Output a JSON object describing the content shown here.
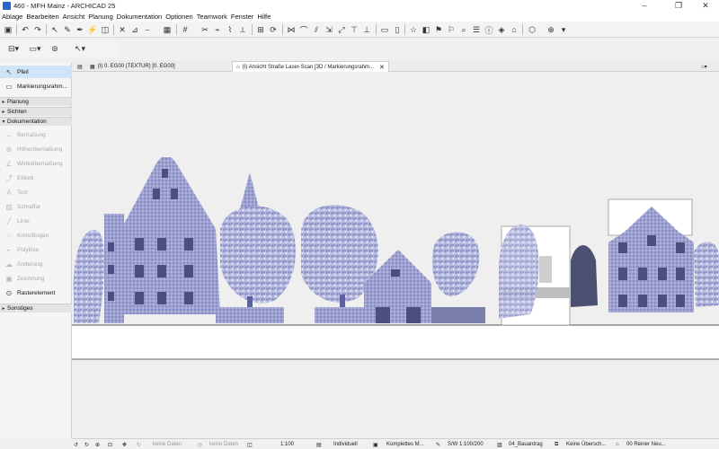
{
  "app": {
    "title": "460 - MFH Mainz - ARCHICAD 25",
    "window_controls": [
      "–",
      "❐",
      "✕"
    ]
  },
  "menu": [
    "Ablage",
    "Bearbeiten",
    "Ansicht",
    "Planung",
    "Dokumentation",
    "Optionen",
    "Teamwork",
    "Fenster",
    "Hilfe"
  ],
  "palette": {
    "arrow_label": "Pfeil",
    "marquee_label": "Markierungsrahm...",
    "sections": {
      "planung": "Planung",
      "sichten": "Sichten",
      "dokumentation": "Dokumentation",
      "sonstiges": "Sonstiges"
    },
    "doc_tools": [
      "Bemaßung",
      "Höhenbemaßung",
      "Winkelbemaßung",
      "Etikett",
      "Text",
      "Schraffur",
      "Linie",
      "Kreis/Bogen",
      "Polylinie",
      "Änderung",
      "Zeichnung",
      "Rasterelement"
    ]
  },
  "tabs": {
    "tab1": "(I) 0. EG00 (TEXTUR) [0. EG00]",
    "tab2": "(I) Ansicht Straße Laser-Scan [3D / Markierungsrahm..."
  },
  "status": {
    "nodata1": "keine Daten",
    "nodata2": "keine Daten",
    "scale": "1:100",
    "layer_combo": "Individuell",
    "model_view": "Komplettes M...",
    "pen_set": "S/W 1:100/200",
    "layout": "04_Bauantrag",
    "override": "Keine Übersch...",
    "renovation": "00 Reiner Neu..."
  },
  "colors": {
    "selected": "#cfe4f7",
    "accent": "#2a66c8",
    "pointcloud": "#8a8fc4"
  }
}
